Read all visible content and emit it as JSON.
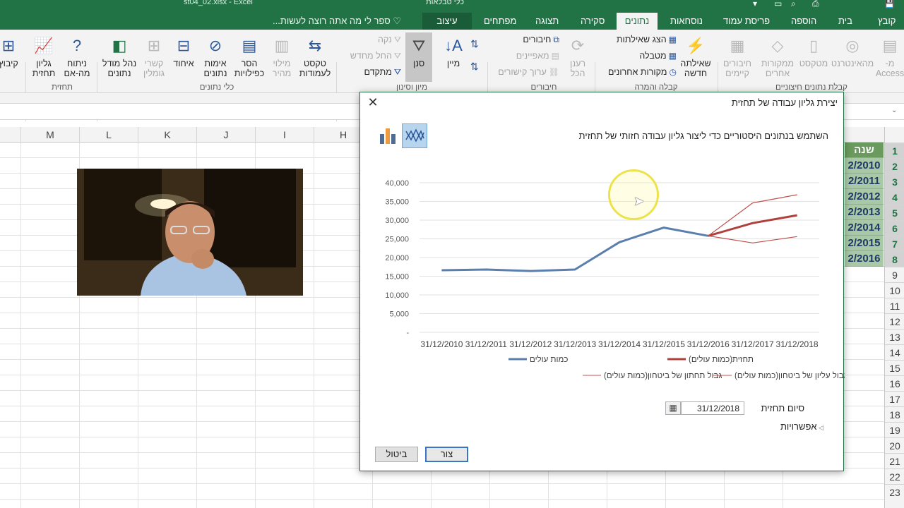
{
  "app": {
    "file_title": "st04_02.xlsx - Excel",
    "context_title": "כלי טבלאות"
  },
  "tabs": {
    "file": "קובץ",
    "home": "בית",
    "insert": "הוספה",
    "page_layout": "פריסת עמוד",
    "formulas": "נוסחאות",
    "data": "נתונים",
    "review": "סקירה",
    "view": "תצוגה",
    "developer": "מפתחים",
    "design": "עיצוב"
  },
  "tell_me": "ספר לי מה אתה רוצה לעשות...",
  "ribbon": {
    "access": "מ-\nAccess",
    "web": "מהאינטרנט",
    "text": "מטקסט",
    "other_sources": "ממקורות\nאחרים",
    "existing_connections": "חיבורים\nקיימים",
    "get_external_group": "קבלת נתונים חיצוניים",
    "new_query": "שאילתה\nחדשה",
    "show_queries": "הצג שאילתות",
    "from_table": "מטבלה",
    "recent_sources": "מקורות אחרונים",
    "get_transform_group": "קבלה והמרה",
    "refresh_all": "רענן\nהכל",
    "connections": "חיבורים",
    "properties": "מאפיינים",
    "edit_links": "ערוך קישורים",
    "connections_group": "חיבורים",
    "sort": "מיין",
    "filter": "סנן",
    "clear": "נקה",
    "reapply": "החל מחדש",
    "advanced": "מתקדם",
    "sort_filter_group": "מיון וסינון",
    "text_to_columns": "טקסט\nלעמודות",
    "flash_fill": "מילוי\nמהיר",
    "remove_duplicates": "הסר\nכפילויות",
    "data_validation": "אימות\nנתונים",
    "consolidate": "איחוד",
    "relationships": "קשרי\nגומלין",
    "manage_data_model": "נהל מודל\nנתונים",
    "data_tools_group": "כלי נתונים",
    "what_if": "ניתוח\nמה-אם",
    "forecast_sheet": "גליון\nתחזית",
    "forecast_group": "תחזית",
    "outline": "קיבוץ"
  },
  "columns": [
    "M",
    "L",
    "K",
    "J",
    "I",
    "H"
  ],
  "rows": [
    "1",
    "2",
    "3",
    "4",
    "5",
    "6",
    "7",
    "8",
    "9",
    "10",
    "11",
    "12",
    "13",
    "14",
    "15",
    "16",
    "17",
    "18",
    "19",
    "20",
    "21",
    "22",
    "23"
  ],
  "sheet_data": {
    "header": "שנה",
    "years": [
      "2/2010",
      "2/2011",
      "2/2012",
      "2/2013",
      "2/2014",
      "2/2015",
      "2/2016"
    ]
  },
  "dialog": {
    "title": "יצירת גליון עבודה של תחזית",
    "description": "השתמש בנתונים היסטוריים כדי ליצור גליון עבודה חזותי של תחזית",
    "end_label": "סיום תחזית",
    "end_value": "31/12/2018",
    "options_label": "אפשרויות",
    "create_label": "צור",
    "cancel_label": "ביטול",
    "close_glyph": "✕",
    "calendar_icon": "calendar-icon",
    "options_icon": "triangle-right-icon"
  },
  "chart_data": {
    "type": "line",
    "categories": [
      "31/12/2010",
      "31/12/2011",
      "31/12/2012",
      "31/12/2013",
      "31/12/2014",
      "31/12/2015",
      "31/12/2016",
      "31/12/2017",
      "31/12/2018"
    ],
    "yticks": [
      "-",
      "5,000",
      "10,000",
      "15,000",
      "20,000",
      "25,000",
      "30,000",
      "35,000",
      "40,000"
    ],
    "ylim": [
      0,
      40000
    ],
    "series": [
      {
        "name": "כמות עולים",
        "color": "#5b7fad",
        "width": 3,
        "values": [
          16600,
          16800,
          16400,
          16800,
          24100,
          28000,
          25800,
          null,
          null
        ]
      },
      {
        "name": "תחזית(כמות עולים)",
        "color": "#b0403c",
        "width": 3,
        "values": [
          null,
          null,
          null,
          null,
          null,
          null,
          25800,
          29200,
          31300
        ]
      },
      {
        "name": "גבול תחתון של ביטחון(כמות עולים)",
        "color": "#c0504d",
        "width": 1.2,
        "values": [
          null,
          null,
          null,
          null,
          null,
          null,
          25800,
          23900,
          25600
        ]
      },
      {
        "name": "גבול עליון של ביטחון(כמות עולים)",
        "color": "#c0504d",
        "width": 1.2,
        "values": [
          null,
          null,
          null,
          null,
          null,
          null,
          25800,
          34600,
          36800
        ]
      }
    ],
    "legend_order": [
      0,
      1,
      2,
      3
    ],
    "legend": "bottom",
    "grid": true
  }
}
